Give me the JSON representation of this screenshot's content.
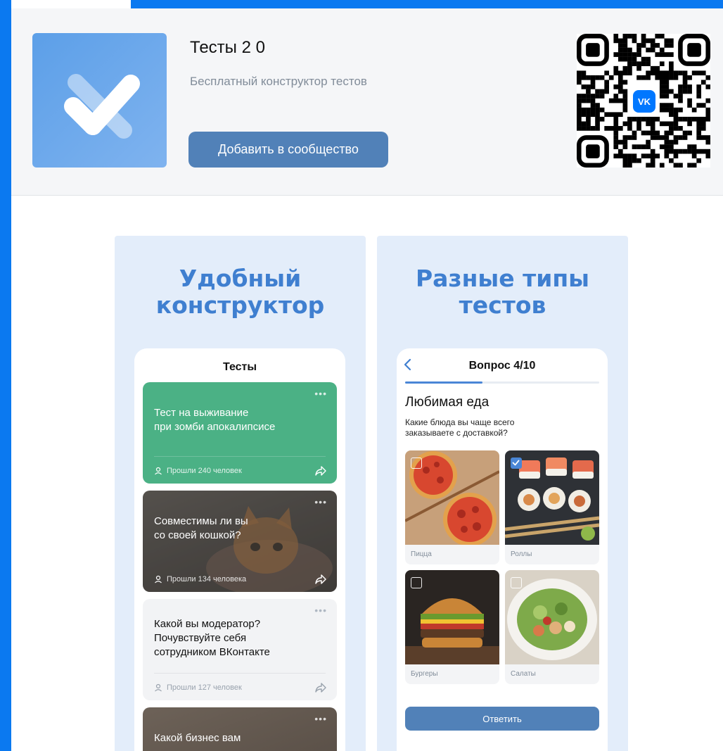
{
  "app": {
    "title": "Тесты 2 0",
    "subtitle": "Бесплатный конструктор тестов",
    "add_button": "Добавить в сообщество",
    "qr_badge": "VK"
  },
  "screenshots": [
    {
      "heading_line1": "Удобный",
      "heading_line2": "конструктор",
      "phone_title": "Тесты",
      "cards": [
        {
          "title_line1": "Тест на выживание",
          "title_line2": "при зомби апокалипсисе",
          "meta": "Прошли 240 человек",
          "dots": "•••"
        },
        {
          "title_line1": "Совместимы ли вы",
          "title_line2": "со своей кошкой?",
          "meta": "Прошли 134 человека",
          "dots": "•••"
        },
        {
          "title_line1": "Какой вы модератор?",
          "title_line2": "Почувствуйте себя",
          "title_line3": "сотрудником ВКонтакте",
          "meta": "Прошли 127 человек",
          "dots": "•••"
        },
        {
          "title_line1": "Какой бизнес вам",
          "dots": "•••"
        }
      ]
    },
    {
      "heading_line1": "Разные типы",
      "heading_line2": "тестов",
      "question_counter": "Вопрос 4/10",
      "progress": 0.4,
      "question_heading": "Любимая еда",
      "question_text": "Какие блюда вы чаще всего заказываете с доставкой?",
      "options": [
        {
          "label": "Пицца",
          "checked": false
        },
        {
          "label": "Роллы",
          "checked": true
        },
        {
          "label": "Бургеры",
          "checked": false
        },
        {
          "label": "Салаты",
          "checked": false
        }
      ],
      "answer_button": "Ответить"
    }
  ],
  "colors": {
    "frame": "#0b79f0",
    "accent": "#5181b8",
    "heading": "#3f7fd0",
    "card_green": "#4bb185"
  }
}
